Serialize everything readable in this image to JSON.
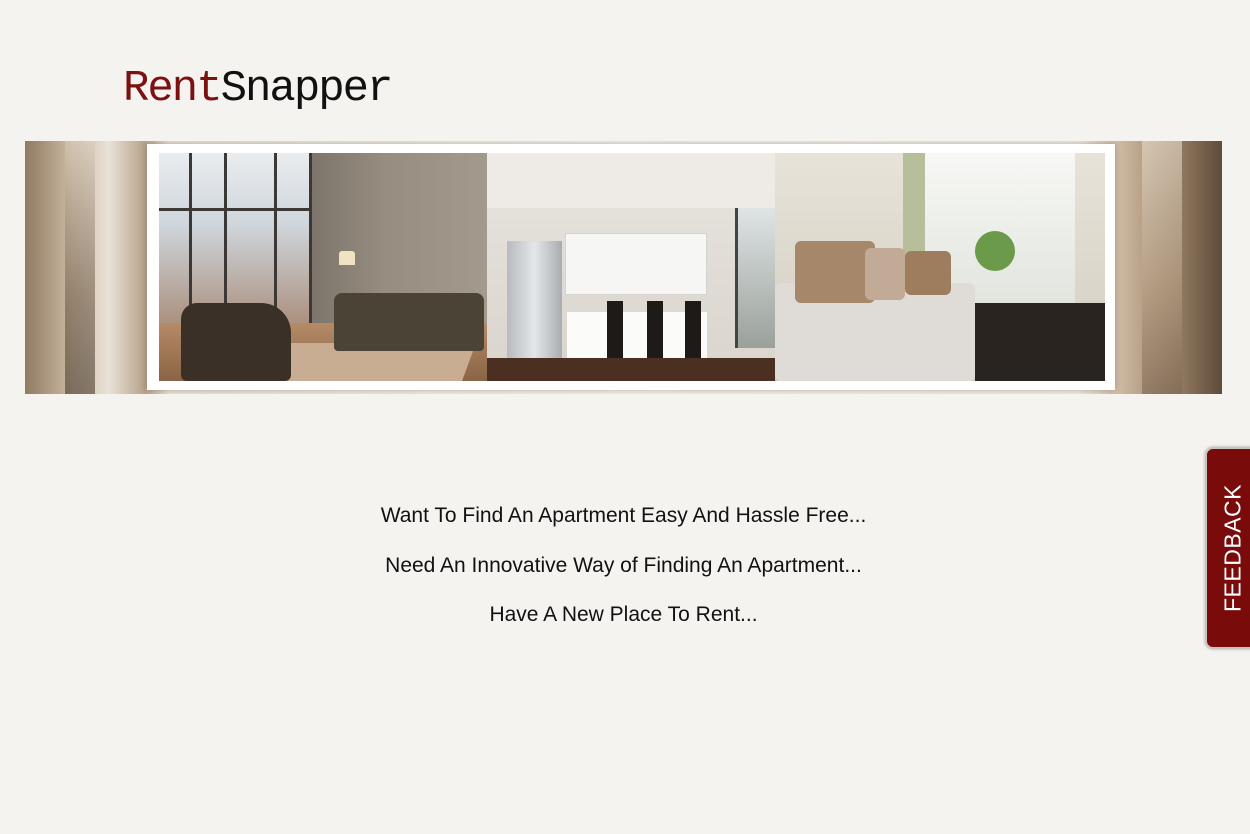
{
  "brand": {
    "logo_part_a": "Rent",
    "logo_part_b": "Snapper",
    "logo_colors": {
      "part_a": "#7a1212",
      "part_b": "#111111"
    }
  },
  "banner": {
    "photos": [
      "loft-living-room-photo",
      "kitchen-photo",
      "bright-living-room-photo"
    ]
  },
  "main": {
    "taglines": [
      "Want To Find An Apartment Easy And Hassle Free...",
      "Need An Innovative Way of Finding An Apartment...",
      "Have A New Place To Rent..."
    ]
  },
  "feedback": {
    "label": "FEEDBACK",
    "color": "#7a0b0b"
  }
}
